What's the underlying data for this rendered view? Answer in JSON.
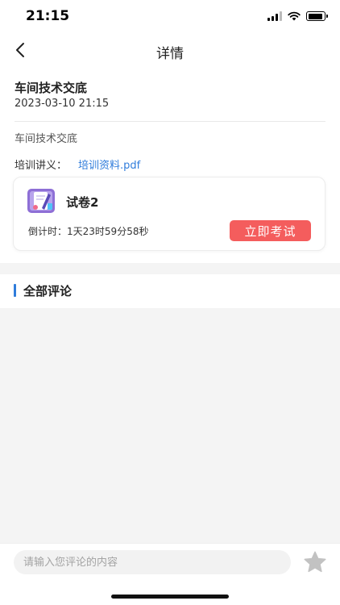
{
  "status_bar": {
    "time": "21:15"
  },
  "nav": {
    "title": "详情",
    "back_icon": "chevron-left-icon"
  },
  "article": {
    "title": "车间技术交底",
    "date": "2023-03-10 21:15",
    "body": "车间技术交底",
    "handout_label": "培训讲义：",
    "handout_file": "培训资料.pdf"
  },
  "exam": {
    "icon": "exam-paper-icon",
    "title": "试卷2",
    "countdown_label": "倒计时：",
    "countdown_value": "1天23时59分58秒",
    "start_button": "立即考试",
    "button_color": "#f45d5d"
  },
  "comments": {
    "title": "全部评论",
    "accent_color": "#2f7cdb"
  },
  "input_bar": {
    "placeholder": "请输入您评论的内容",
    "star_icon": "star-icon"
  }
}
